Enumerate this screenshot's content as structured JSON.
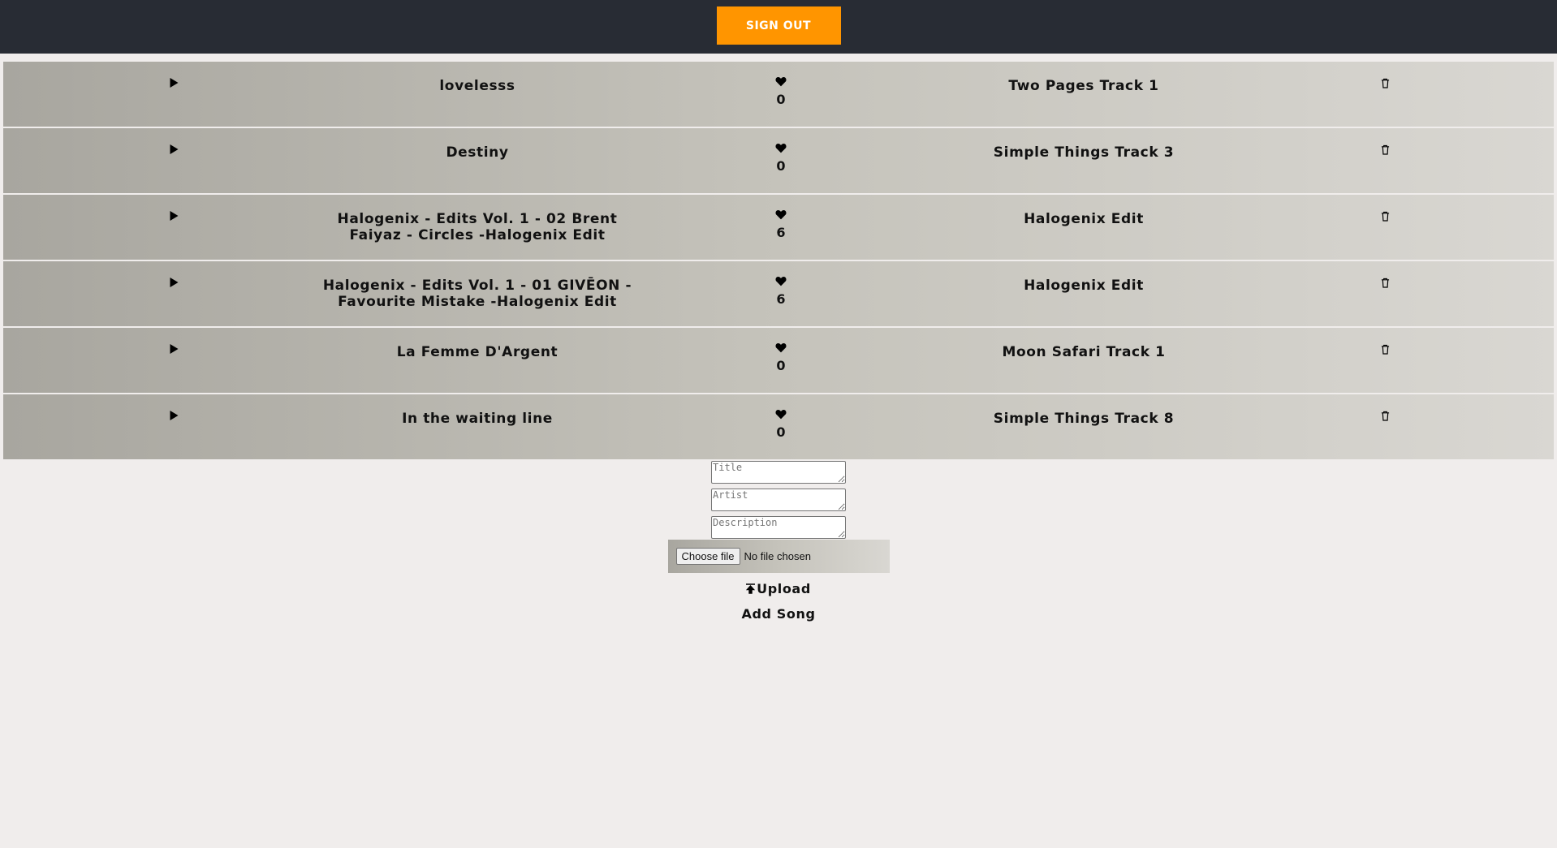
{
  "header": {
    "signout_label": "SIGN OUT"
  },
  "songs": [
    {
      "title": "lovelesss",
      "likes": "0",
      "album": "Two Pages Track 1"
    },
    {
      "title": "Destiny",
      "likes": "0",
      "album": "Simple Things Track 3"
    },
    {
      "title": "Halogenix - Edits Vol. 1 - 02 Brent Faiyaz - Circles -Halogenix Edit",
      "likes": "6",
      "album": "Halogenix Edit"
    },
    {
      "title": "Halogenix - Edits Vol. 1 - 01 GIVĒON - Favourite Mistake -Halogenix Edit",
      "likes": "6",
      "album": "Halogenix Edit"
    },
    {
      "title": "La Femme D'Argent",
      "likes": "0",
      "album": "Moon Safari Track 1"
    },
    {
      "title": "In the waiting line",
      "likes": "0",
      "album": "Simple Things Track 8"
    }
  ],
  "icons": {
    "play": "play-icon",
    "heart": "heart-icon",
    "trash": "trash-icon",
    "upload": "upload-icon"
  },
  "form": {
    "title_placeholder": "Title",
    "artist_placeholder": "Artist",
    "description_placeholder": "Description",
    "file_button": "Choose file",
    "file_status": "No file chosen",
    "upload_label": "Upload",
    "add_song_label": "Add Song"
  },
  "colors": {
    "header_bg": "#282c34",
    "accent": "#ff9500",
    "page_bg": "#f0edec"
  }
}
